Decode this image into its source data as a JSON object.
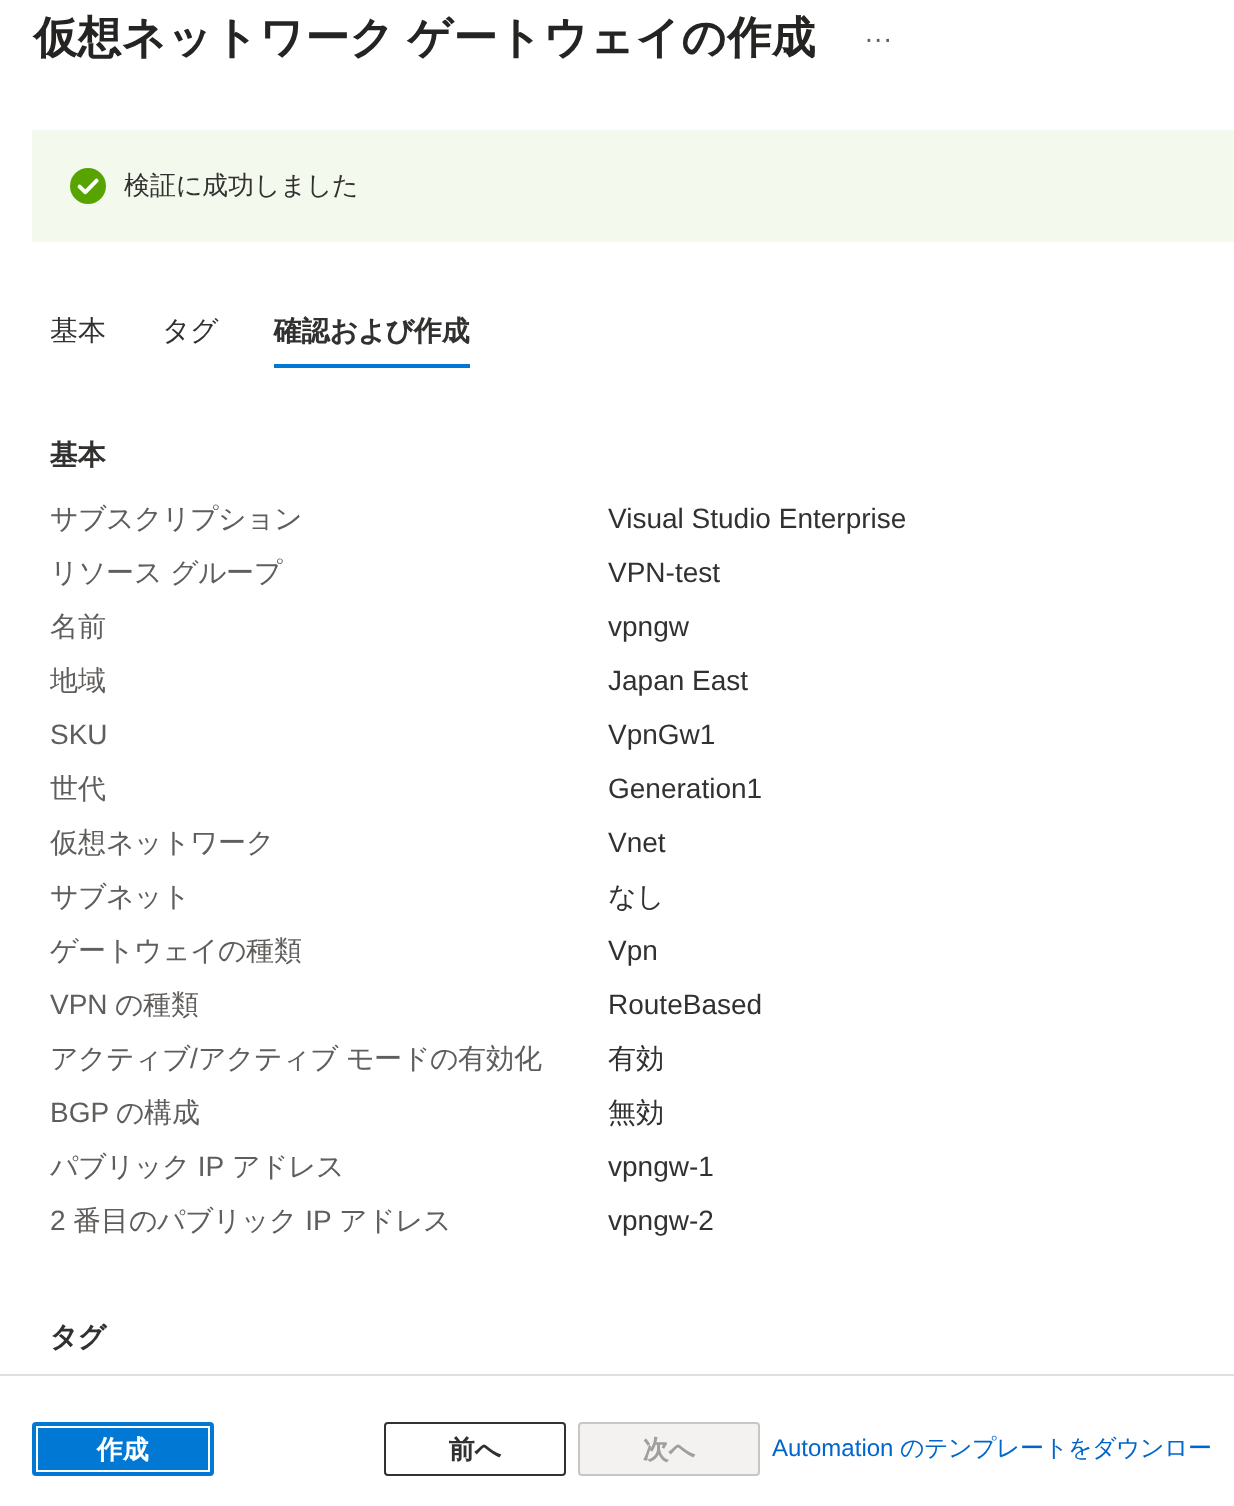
{
  "header": {
    "title": "仮想ネットワーク ゲートウェイの作成",
    "more_button": "···"
  },
  "banner": {
    "kind": "success",
    "text": "検証に成功しました"
  },
  "tabs": [
    {
      "label": "基本",
      "selected": false
    },
    {
      "label": "タグ",
      "selected": false
    },
    {
      "label": "確認および作成",
      "selected": true
    }
  ],
  "sections": [
    {
      "heading": "基本",
      "rows": [
        {
          "label": "サブスクリプション",
          "value": "Visual Studio Enterprise"
        },
        {
          "label": "リソース グループ",
          "value": "VPN-test"
        },
        {
          "label": "名前",
          "value": "vpngw"
        },
        {
          "label": "地域",
          "value": "Japan East"
        },
        {
          "label": "SKU",
          "value": "VpnGw1"
        },
        {
          "label": "世代",
          "value": "Generation1"
        },
        {
          "label": "仮想ネットワーク",
          "value": "Vnet"
        },
        {
          "label": "サブネット",
          "value": "なし"
        },
        {
          "label": "ゲートウェイの種類",
          "value": "Vpn"
        },
        {
          "label": "VPN の種類",
          "value": "RouteBased"
        },
        {
          "label": "アクティブ/アクティブ モードの有効化",
          "value": "有効"
        },
        {
          "label": "BGP の構成",
          "value": "無効"
        },
        {
          "label": "パブリック IP アドレス",
          "value": "vpngw-1"
        },
        {
          "label": "2 番目のパブリック IP アドレス",
          "value": "vpngw-2"
        }
      ]
    },
    {
      "heading": "タグ"
    }
  ],
  "footer": {
    "actions": [
      {
        "kind": "primary",
        "label": "作成",
        "disabled": false,
        "focused": true
      },
      {
        "kind": "default",
        "label": "前へ",
        "disabled": false,
        "focused": false
      },
      {
        "kind": "default",
        "label": "次へ",
        "disabled": true,
        "focused": false
      },
      {
        "kind": "link",
        "label": "Automation のテンプレートをダウンロー",
        "disabled": false,
        "focused": false
      }
    ]
  }
}
